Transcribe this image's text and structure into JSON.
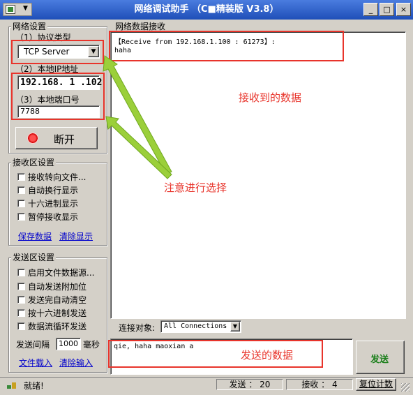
{
  "window": {
    "title": "网络调试助手 （C■精装版 V3.8）",
    "minimize_label": "_",
    "maximize_label": "□",
    "close_label": "×"
  },
  "settings": {
    "group_label": "网络设置",
    "protocol_label": "（1）协议类型",
    "protocol_value": "TCP Server",
    "ip_label": "（2）本地IP地址",
    "ip_value": "192.168. 1 .102",
    "port_label": "（3）本地端口号",
    "port_value": "7788",
    "disconnect_label": "断开"
  },
  "receive_settings": {
    "group_label": "接收区设置",
    "options": [
      "接收转向文件...",
      "自动换行显示",
      "十六进制显示",
      "暂停接收显示"
    ],
    "save_label": "保存数据",
    "clear_label": "清除显示"
  },
  "send_settings": {
    "group_label": "发送区设置",
    "options": [
      "启用文件数据源...",
      "自动发送附加位",
      "发送完自动清空",
      "按十六进制发送",
      "数据流循环发送"
    ],
    "interval_label": "发送间隔",
    "interval_value": "1000",
    "interval_unit": "毫秒",
    "load_file_label": "文件载入",
    "clear_input_label": "清除输入"
  },
  "receive_area": {
    "label": "网络数据接收",
    "header_line": "【Receive from 192.168.1.100 : 61273】:",
    "data_line": "haha"
  },
  "connection": {
    "label": "连接对象:",
    "value": "All Connections"
  },
  "send_area": {
    "text": "qie, haha maoxian a",
    "send_button": "发送"
  },
  "annotations": {
    "received_data": "接收到的数据",
    "select_note": "注意进行选择",
    "send_data": "发送的数据",
    "color": "#e8342b"
  },
  "status_bar": {
    "status_text": "就绪!",
    "sent_label": "发送 ： 20",
    "received_label": "接收 ： 4",
    "reset_label": "复位计数"
  }
}
